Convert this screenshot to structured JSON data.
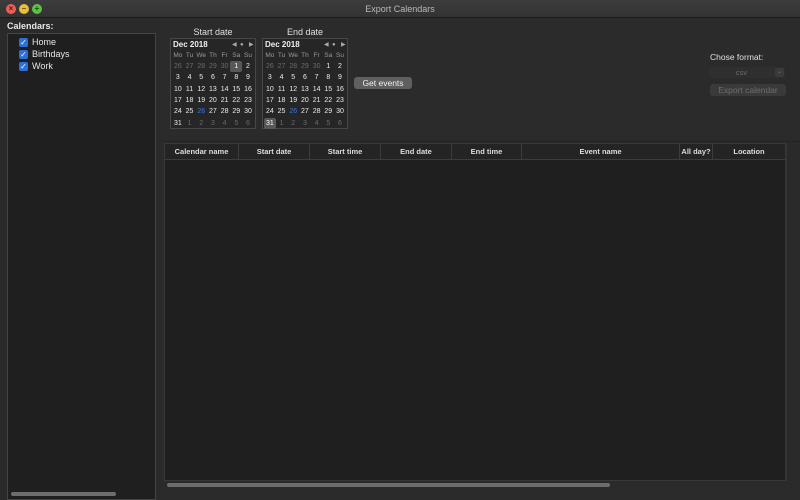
{
  "window": {
    "title": "Export Calendars"
  },
  "calendars": {
    "heading": "Calendars:",
    "items": [
      {
        "label": "Home",
        "checked": true
      },
      {
        "label": "Birthdays",
        "checked": true
      },
      {
        "label": "Work",
        "checked": true
      }
    ]
  },
  "start_date": {
    "title": "Start date",
    "month": "Dec 2018",
    "dow": [
      "Mo",
      "Tu",
      "We",
      "Th",
      "Fr",
      "Sa",
      "Su"
    ],
    "weeks": [
      [
        "26",
        "27",
        "28",
        "29",
        "30",
        "1",
        "2"
      ],
      [
        "3",
        "4",
        "5",
        "6",
        "7",
        "8",
        "9"
      ],
      [
        "10",
        "11",
        "12",
        "13",
        "14",
        "15",
        "16"
      ],
      [
        "17",
        "18",
        "19",
        "20",
        "21",
        "22",
        "23"
      ],
      [
        "24",
        "25",
        "26",
        "27",
        "28",
        "29",
        "30"
      ],
      [
        "31",
        "1",
        "2",
        "3",
        "4",
        "5",
        "6"
      ]
    ],
    "selected": "1"
  },
  "end_date": {
    "title": "End date",
    "month": "Dec 2018",
    "dow": [
      "Mo",
      "Tu",
      "We",
      "Th",
      "Fr",
      "Sa",
      "Su"
    ],
    "weeks": [
      [
        "26",
        "27",
        "28",
        "29",
        "30",
        "1",
        "2"
      ],
      [
        "3",
        "4",
        "5",
        "6",
        "7",
        "8",
        "9"
      ],
      [
        "10",
        "11",
        "12",
        "13",
        "14",
        "15",
        "16"
      ],
      [
        "17",
        "18",
        "19",
        "20",
        "21",
        "22",
        "23"
      ],
      [
        "24",
        "25",
        "26",
        "27",
        "28",
        "29",
        "30"
      ],
      [
        "31",
        "1",
        "2",
        "3",
        "4",
        "5",
        "6"
      ]
    ],
    "selected": "31"
  },
  "actions": {
    "get_events": "Get events",
    "format_label": "Chose format:",
    "format_value": "csv",
    "export": "Export calendar"
  },
  "table": {
    "columns": [
      "Calendar name",
      "Start date",
      "Start time",
      "End date",
      "End time",
      "Event name",
      "All day?",
      "Location"
    ],
    "rows": []
  },
  "colors": {
    "accent": "#2e6fd8",
    "today": "#3c78d8"
  }
}
